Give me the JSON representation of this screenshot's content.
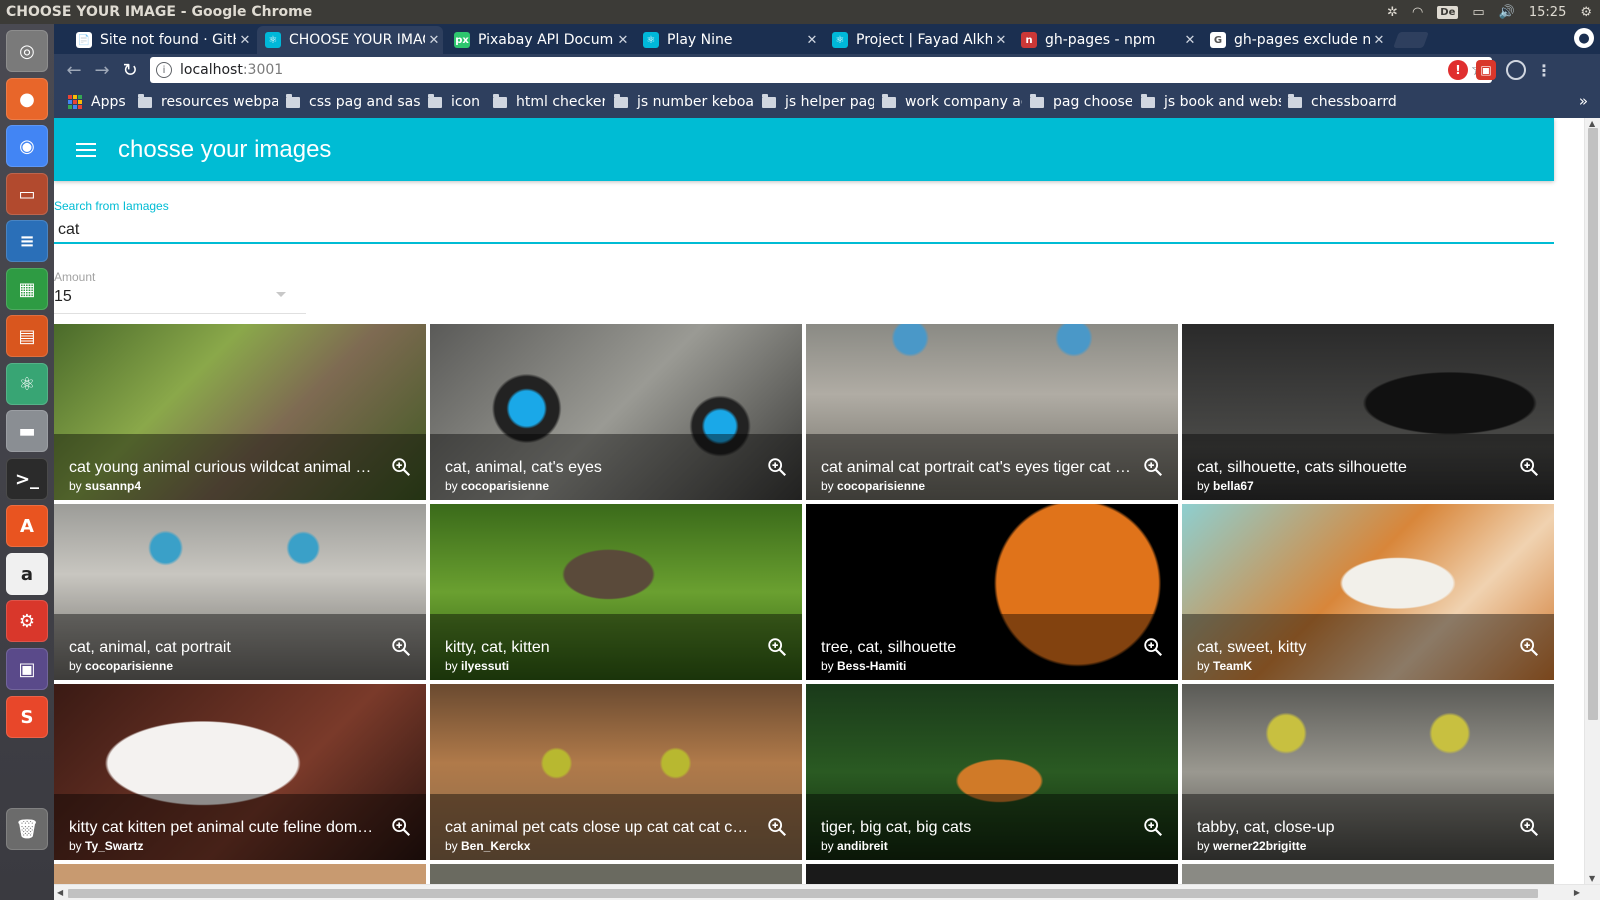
{
  "os": {
    "window_title": "CHOOSE YOUR IMAGE - Google Chrome",
    "keyboard_layout": "De",
    "clock": "15:25"
  },
  "launcher": [
    {
      "name": "dash-icon",
      "color": "#7a7a7a",
      "glyph": "◎"
    },
    {
      "name": "firefox-icon",
      "color": "#e8662a",
      "glyph": "●"
    },
    {
      "name": "chrome-icon",
      "color": "#4285f4",
      "glyph": "◉"
    },
    {
      "name": "files-icon",
      "color": "#b24a2e",
      "glyph": "▭"
    },
    {
      "name": "writer-icon",
      "color": "#2a6fb8",
      "glyph": "≡"
    },
    {
      "name": "calc-icon",
      "color": "#2e9b43",
      "glyph": "▦"
    },
    {
      "name": "impress-icon",
      "color": "#d9561e",
      "glyph": "▤"
    },
    {
      "name": "atom-icon",
      "color": "#38a574",
      "glyph": "⚛"
    },
    {
      "name": "print-icon",
      "color": "#8a8e93",
      "glyph": "▬"
    },
    {
      "name": "terminal-icon",
      "color": "#2b2b2b",
      "glyph": ">_"
    },
    {
      "name": "software-center-icon",
      "color": "#e95420",
      "glyph": "A"
    },
    {
      "name": "amazon-icon",
      "color": "#f0f0f0",
      "glyph": "a"
    },
    {
      "name": "settings-icon",
      "color": "#d9372b",
      "glyph": "⚙"
    },
    {
      "name": "workspaces-icon",
      "color": "#5a4a8a",
      "glyph": "▣"
    },
    {
      "name": "slack-icon",
      "color": "#e8472a",
      "glyph": "S"
    },
    {
      "name": "trash-icon",
      "color": "#6b6b6b",
      "glyph": "🗑"
    }
  ],
  "tabs": [
    {
      "label": "Site not found · GitHub Pages",
      "fav": "#ffffff",
      "fav_glyph": "📄",
      "active": false
    },
    {
      "label": "CHOOSE YOUR IMAGE",
      "fav": "#00b8d9",
      "fav_glyph": "⚛",
      "active": true
    },
    {
      "label": "Pixabay API Documentation",
      "fav": "#2ec66e",
      "fav_glyph": "px",
      "active": false
    },
    {
      "label": "Play Nine",
      "fav": "#00b8d9",
      "fav_glyph": "⚛",
      "active": false
    },
    {
      "label": "Project | Fayad Alkhalil",
      "fav": "#00b8d9",
      "fav_glyph": "⚛",
      "active": false
    },
    {
      "label": "gh-pages - npm",
      "fav": "#cb3837",
      "fav_glyph": "n",
      "active": false
    },
    {
      "label": "gh-pages exclude node_modules",
      "fav": "#ffffff",
      "fav_glyph": "G",
      "active": false
    }
  ],
  "omnibox": {
    "host": "localhost",
    "port": ":3001"
  },
  "bookmarks": [
    {
      "label": "Apps",
      "type": "apps"
    },
    {
      "label": "resources webpage",
      "type": "folder"
    },
    {
      "label": "css pag and sass",
      "type": "folder"
    },
    {
      "label": "icon",
      "type": "folder"
    },
    {
      "label": "html checker",
      "type": "folder"
    },
    {
      "label": "js number keboard",
      "type": "folder"
    },
    {
      "label": "js helper pag",
      "type": "folder"
    },
    {
      "label": "work company address",
      "type": "folder"
    },
    {
      "label": "pag choose",
      "type": "folder"
    },
    {
      "label": "js book and website",
      "type": "folder"
    },
    {
      "label": "chessboarrd",
      "type": "folder"
    }
  ],
  "app": {
    "title": "chosse your images",
    "search_label": "Search from Iamages",
    "search_value": "cat",
    "amount_label": "Amount",
    "amount_value": "15"
  },
  "images": [
    {
      "title": "cat young animal curious wildcat animal cat kitten",
      "author": "susannp4",
      "bg": "linear-gradient(135deg,#4a6a2a 0%,#8aa84a 35%,#7e6a52 60%,#3f5a22 100%)"
    },
    {
      "title": "cat, animal, cat's eyes",
      "author": "cocoparisienne",
      "bg": "radial-gradient(circle at 26% 48%,#1aa8e8 0 6%,#222 7% 11%,transparent 12%),radial-gradient(circle at 78% 58%,#1aa8e8 0 5%,#222 6% 9%,transparent 10%),linear-gradient(135deg,#5a5a58,#9a9a94 50%,#3a3a38)"
    },
    {
      "title": "cat animal cat portrait cat's eyes tiger cat domestic cat",
      "author": "cocoparisienne",
      "bg": "radial-gradient(circle at 28% 8%,#4a98c8 0 5%,transparent 6%),radial-gradient(circle at 72% 8%,#4a98c8 0 5%,transparent 6%),linear-gradient(180deg,#8a8a84,#b0aca4 40%,#6a6860)"
    },
    {
      "title": "cat, silhouette, cats silhouette",
      "author": "bella67",
      "bg": "radial-gradient(ellipse at 72% 45%,#111 0 22%,transparent 23%),linear-gradient(180deg,#2a2a2a,#4a4a48 70%,#2e2e2e)"
    },
    {
      "title": "cat, animal, cat portrait",
      "author": "cocoparisienne",
      "bg": "radial-gradient(circle at 30% 25%,#3aa0c8 0 5%,transparent 6%),radial-gradient(circle at 67% 25%,#3aa0c8 0 5%,transparent 6%),linear-gradient(180deg,#9c9c98,#c8c6c0 40%,#6a6864)"
    },
    {
      "title": "kitty, cat, kitten",
      "author": "ilyessuti",
      "bg": "radial-gradient(ellipse at 48% 40%,#5a4a3a 0 16%,transparent 17%),linear-gradient(180deg,#3a6a1a,#6aa030 50%,#2e5a12)"
    },
    {
      "title": "tree, cat, silhouette",
      "author": "Bess-Hamiti",
      "bg": "radial-gradient(circle at 73% 45%,#e0731a 0 28%,#000 29%),#000"
    },
    {
      "title": "cat, sweet, kitty",
      "author": "TeamK",
      "bg": "radial-gradient(ellipse at 58% 45%,#f2f0ea 0 18%,transparent 19%),linear-gradient(135deg,#8ecfd0 0%,#d8863a 45%,#f0d2b0 70%,#d07830 100%)"
    },
    {
      "title": "kitty cat kitten pet animal cute feline domestic cat",
      "author": "Ty_Swartz",
      "bg": "radial-gradient(ellipse at 40% 45%,#f4f2f0 0 30%,transparent 31%),linear-gradient(135deg,#3a1a14,#7a3a2a 60%,#2a1410)"
    },
    {
      "title": "cat animal pet cats close up cat cat cat cat cat",
      "author": "Ben_Kerckx",
      "bg": "radial-gradient(circle at 34% 45%,#b8b830 0 5%,transparent 6%),radial-gradient(circle at 66% 45%,#b8b830 0 5%,transparent 6%),linear-gradient(180deg,#6a4a30,#b07a4a 45%,#8a6a4a)"
    },
    {
      "title": "tiger, big cat, big cats",
      "author": "andibreit",
      "bg": "radial-gradient(ellipse at 52% 55%,#d07a28 0 15%,transparent 16%),linear-gradient(180deg,#1a3a1a,#2a5a22 50%,#12280e)"
    },
    {
      "title": "tabby, cat, close-up",
      "author": "werner22brigitte",
      "bg": "radial-gradient(circle at 28% 28%,#c8c040 0 6%,transparent 7%),radial-gradient(circle at 72% 28%,#c8c040 0 6%,transparent 7%),linear-gradient(180deg,#5a5a56,#9a9890 50%,#4a4a46)"
    }
  ]
}
